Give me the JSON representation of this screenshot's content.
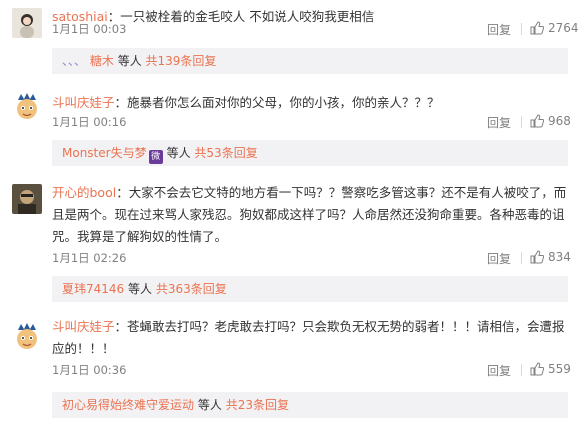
{
  "comments": [
    {
      "username": "satoshiai",
      "text": "一只被栓着的金毛咬人 不如说人咬狗我更相信",
      "time": "1月1日 00:03",
      "reply_label": "回复",
      "likes": "2764",
      "sub": {
        "prefix": "、、、",
        "user": "糖木",
        "middle": "等人",
        "count": "共139条回复"
      }
    },
    {
      "username": "斗叫庆娃子",
      "text": "施暴者你怎么面对你的父母，你的小孩，你的亲人？？？",
      "time": "1月1日 00:16",
      "reply_label": "回复",
      "likes": "968",
      "sub": {
        "prefix": "",
        "user": "Monster失与梦",
        "badge": "微",
        "middle": "等人",
        "count": "共53条回复"
      }
    },
    {
      "username": "开心的bool",
      "text": "大家不会去它文特的地方看一下吗？？警察吃多管这事？还不是有人被咬了，而且是两个。现在过来骂人家残忍。狗奴都成这样了吗？人命居然还没狗命重要。各种恶毒的诅咒。我算是了解狗奴的性情了。",
      "time": "1月1日 02:26",
      "reply_label": "回复",
      "likes": "834",
      "sub": {
        "prefix": "",
        "user": "夏玮74146",
        "middle": "等人",
        "count": "共363条回复"
      }
    },
    {
      "username": "斗叫庆娃子",
      "text": "苍蝇敢去打吗？老虎敢去打吗？只会欺负无权无势的弱者！！！请相信，会遭报应的！！！",
      "time": "1月1日 00:36",
      "reply_label": "回复",
      "likes": "559",
      "sub": {
        "prefix": "",
        "user": "初心易得始终难守爱运动",
        "middle": "等人",
        "count": "共23条回复"
      }
    }
  ]
}
